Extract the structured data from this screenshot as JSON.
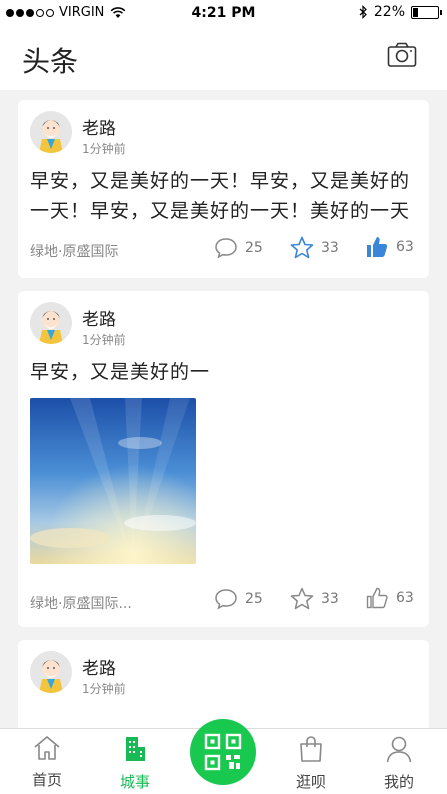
{
  "status_bar": {
    "carrier": "VIRGIN",
    "time": "4:21 PM",
    "battery": "22%",
    "battery_level": 0.22,
    "icons": [
      "signal-dots-icon",
      "wifi-icon",
      "bluetooth-icon",
      "battery-icon"
    ]
  },
  "header": {
    "title": "头条",
    "camera_icon": "camera-icon"
  },
  "posts": [
    {
      "author": "老路",
      "time": "1分钟前",
      "text": "早安，又是美好的一天！早安，又是美好的一天！早安，又是美好的一天！美好的一天",
      "location": "绿地·原盛国际",
      "comments": "25",
      "favorites": "33",
      "likes": "63"
    },
    {
      "author": "老路",
      "time": "1分钟前",
      "text": "早安，又是美好的一",
      "location": "绿地·原盛国际...",
      "comments": "25",
      "favorites": "33",
      "likes": "63"
    },
    {
      "author": "老路",
      "time": "1分钟前"
    }
  ],
  "tabbar": {
    "items": [
      {
        "label": "首页",
        "icon": "home-icon"
      },
      {
        "label": "城事",
        "icon": "building-icon"
      },
      {
        "label": "",
        "icon": "qr-code-icon"
      },
      {
        "label": "逛呗",
        "icon": "shopping-bag-icon"
      },
      {
        "label": "我的",
        "icon": "person-icon"
      }
    ],
    "active_index": 1
  },
  "colors": {
    "accent": "#19c84f",
    "blue_icon": "#3a86d8",
    "background": "#f2f2f2"
  }
}
